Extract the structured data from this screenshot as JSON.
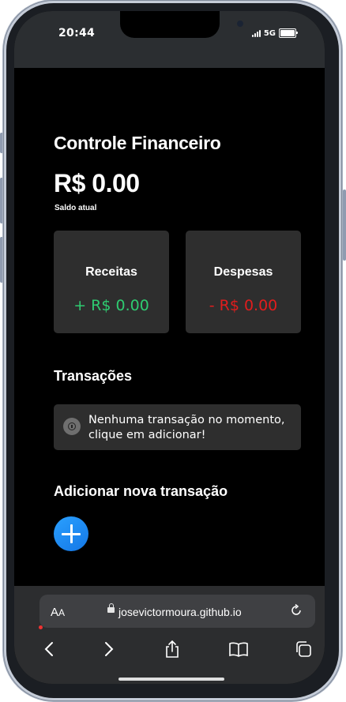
{
  "status_bar": {
    "time": "20:44",
    "network": "5G"
  },
  "app": {
    "title": "Controle Financeiro",
    "balance": "R$ 0.00",
    "balance_label": "Saldo atual",
    "income": {
      "label": "Receitas",
      "value": "+ R$ 0.00"
    },
    "expense": {
      "label": "Despesas",
      "value": "- R$ 0.00"
    },
    "transactions_title": "Transações",
    "empty_message": "Nenhuma transação no momento, clique em adicionar!",
    "add_title": "Adicionar nova transação"
  },
  "browser": {
    "text_size_a_large": "A",
    "text_size_a_small": "A",
    "url": "josevictormoura.github.io"
  },
  "colors": {
    "income": "#2ecc71",
    "expense": "#e11d1d",
    "accent": "#1e88f0",
    "card_bg": "#2e2e2e"
  },
  "icons": [
    "info-icon",
    "plus-icon",
    "lock-icon",
    "reload-icon",
    "back-icon",
    "forward-icon",
    "share-icon",
    "bookmarks-icon",
    "tabs-icon"
  ]
}
